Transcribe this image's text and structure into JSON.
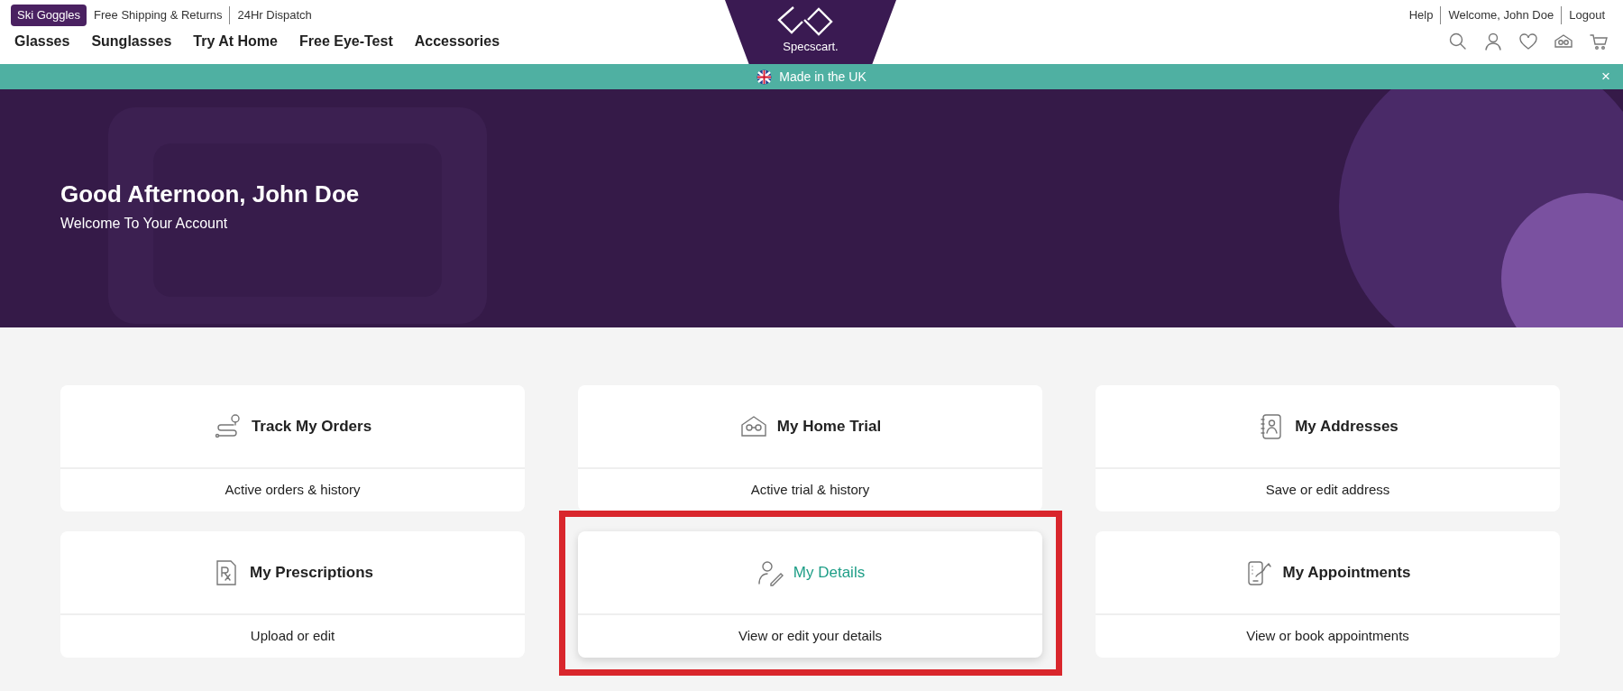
{
  "top_bar": {
    "promo_badge": "Ski Goggles",
    "info_links": [
      "Free Shipping & Returns",
      "24Hr Dispatch"
    ],
    "account_links": [
      "Help",
      "Welcome, John Doe",
      "Logout"
    ]
  },
  "nav": [
    "Glasses",
    "Sunglasses",
    "Try At Home",
    "Free Eye-Test",
    "Accessories"
  ],
  "logo": {
    "text": "Specscart."
  },
  "banner": {
    "text": "Made in the UK",
    "close": "×"
  },
  "hero": {
    "greeting": "Good Afternoon, John Doe",
    "subtitle": "Welcome To Your Account"
  },
  "cards": [
    {
      "title": "Track My Orders",
      "subtitle": "Active orders & history",
      "selected": false,
      "highlighted": false
    },
    {
      "title": "My Home Trial",
      "subtitle": "Active trial & history",
      "selected": false,
      "highlighted": false
    },
    {
      "title": "My Addresses",
      "subtitle": "Save or edit address",
      "selected": false,
      "highlighted": false
    },
    {
      "title": "My Prescriptions",
      "subtitle": "Upload or edit",
      "selected": false,
      "highlighted": false
    },
    {
      "title": "My Details",
      "subtitle": "View or edit your details",
      "selected": true,
      "highlighted": true
    },
    {
      "title": "My Appointments",
      "subtitle": "View or book appointments",
      "selected": false,
      "highlighted": false
    }
  ]
}
